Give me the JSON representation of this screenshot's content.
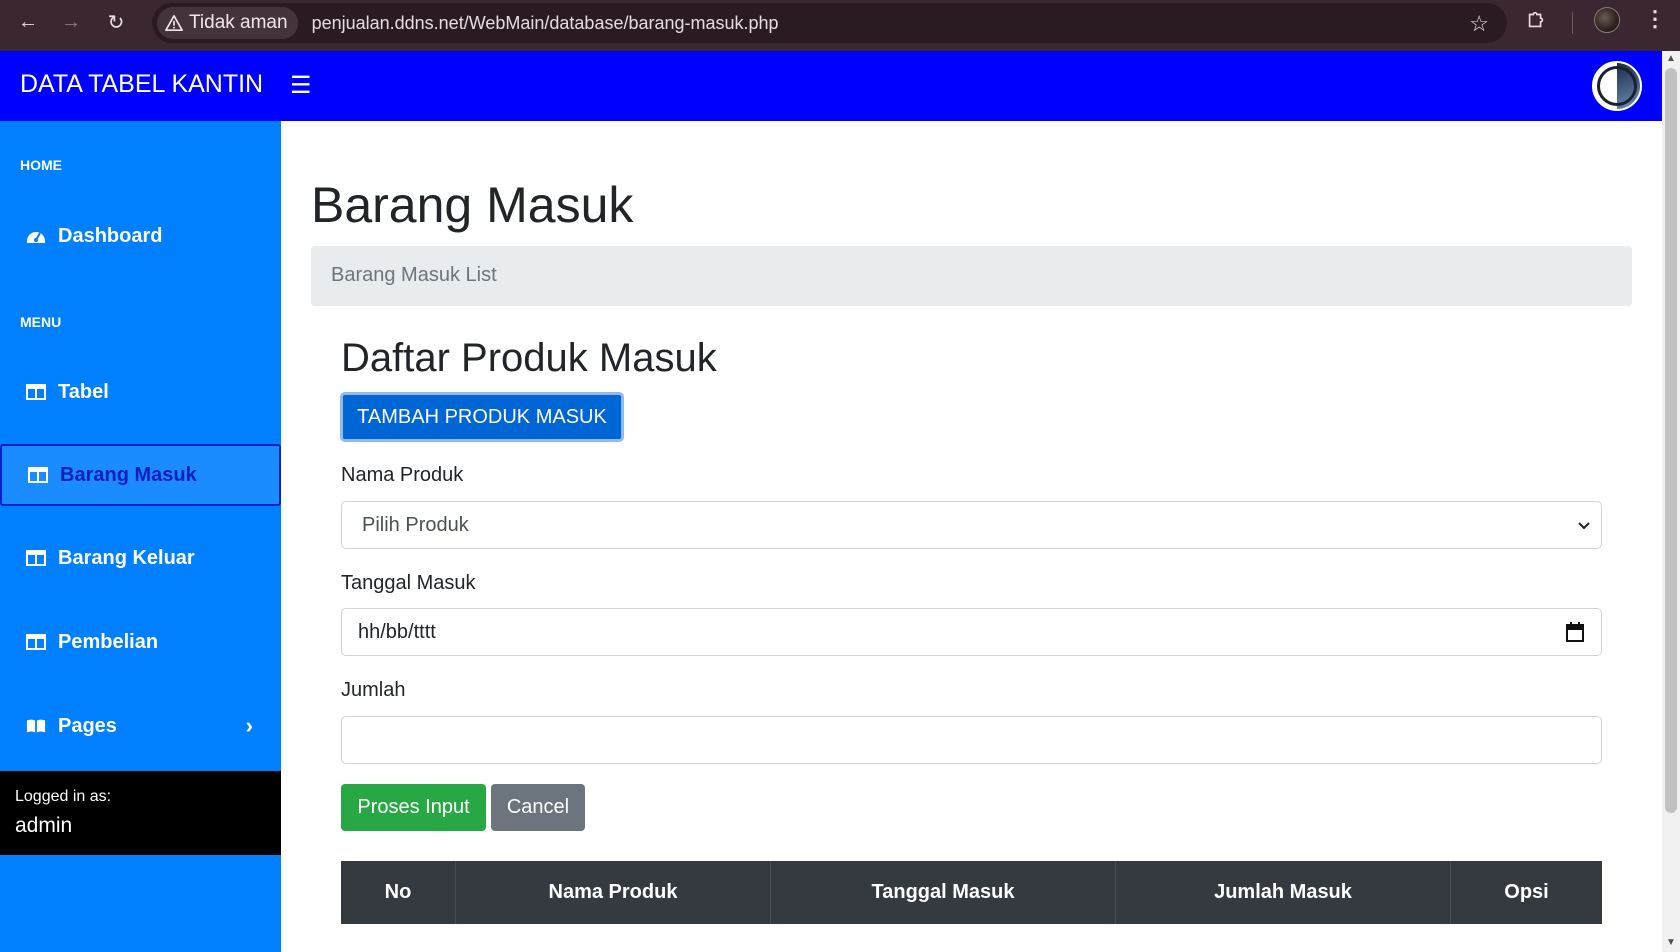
{
  "browser": {
    "security_label": "Tidak aman",
    "url": "penjualan.ddns.net/WebMain/database/barang-masuk.php"
  },
  "header": {
    "brand": "DATA TABEL KANTIN",
    "menu_icon": "hamburger-icon",
    "accent_color": "#0000ff"
  },
  "sidebar": {
    "color": "#0080ff",
    "home_heading": "HOME",
    "menu_heading": "MENU",
    "items": [
      {
        "label": "Dashboard",
        "icon": "tachometer-icon"
      },
      {
        "label": "Tabel",
        "icon": "table-icon"
      },
      {
        "label": "Barang Masuk",
        "icon": "table-icon",
        "active": true
      },
      {
        "label": "Barang Keluar",
        "icon": "table-icon"
      },
      {
        "label": "Pembelian",
        "icon": "table-icon"
      },
      {
        "label": "Pages",
        "icon": "book-open-icon"
      }
    ],
    "footer": {
      "label": "Logged in as:",
      "user": "admin"
    }
  },
  "main": {
    "title": "Barang Masuk",
    "breadcrumb": "Barang Masuk List",
    "section_title": "Daftar Produk Masuk",
    "add_button": "TAMBAH PRODUK MASUK",
    "form": {
      "product_label": "Nama Produk",
      "product_value": "Pilih Produk",
      "date_label": "Tanggal Masuk",
      "date_placeholder": "hh/bb/tttt",
      "qty_label": "Jumlah",
      "qty_value": ""
    },
    "submit_button": "Proses Input",
    "cancel_button": "Cancel",
    "table": {
      "columns": [
        "No",
        "Nama Produk",
        "Tanggal Masuk",
        "Jumlah Masuk",
        "Opsi"
      ]
    }
  }
}
